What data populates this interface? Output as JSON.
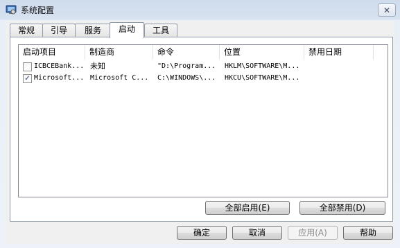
{
  "window": {
    "title": "系统配置",
    "close_glyph": "✕"
  },
  "tabs": [
    {
      "label": "常规"
    },
    {
      "label": "引导"
    },
    {
      "label": "服务"
    },
    {
      "label": "启动",
      "active": true
    },
    {
      "label": "工具"
    }
  ],
  "startup_table": {
    "columns": [
      "启动项目",
      "制造商",
      "命令",
      "位置",
      "禁用日期"
    ],
    "rows": [
      {
        "checked": false,
        "item": "ICBCEBank...",
        "maker": "未知",
        "command": "\"D:\\Program...",
        "location": "HKLM\\SOFTWARE\\M...",
        "disabled_date": ""
      },
      {
        "checked": true,
        "item": "Microsoft...",
        "maker": "Microsoft C...",
        "command": "C:\\WINDOWS\\...",
        "location": "HKCU\\SOFTWARE\\M...",
        "disabled_date": ""
      }
    ]
  },
  "panel_buttons": {
    "enable_all": "全部启用(E)",
    "disable_all": "全部禁用(D)"
  },
  "dialog_buttons": {
    "ok": "确定",
    "cancel": "取消",
    "apply": "应用(A)",
    "help": "帮助"
  }
}
